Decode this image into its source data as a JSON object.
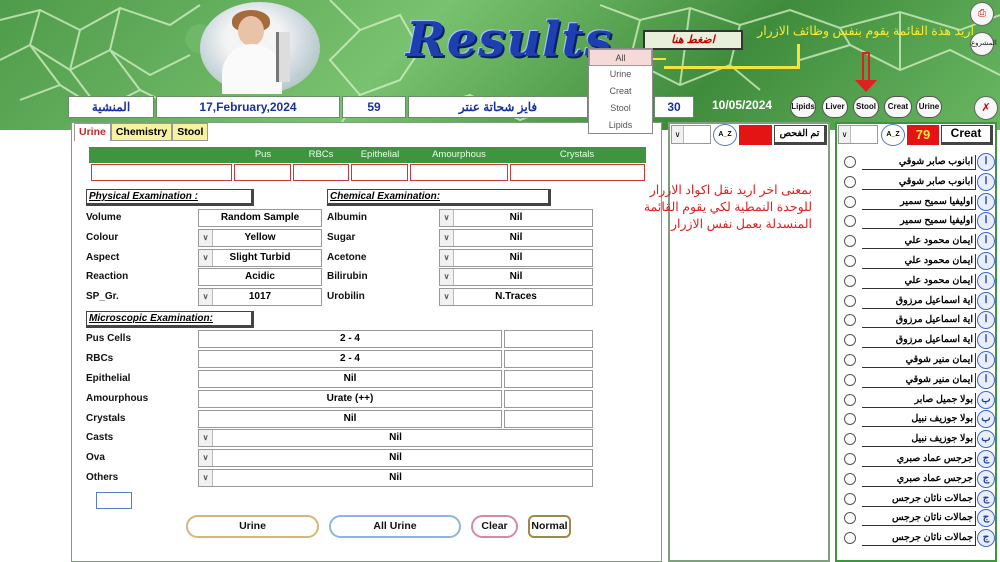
{
  "header": {
    "title": "Results",
    "press_here": "اضغط هنا",
    "note_top": "اريد هذة القائمة يقوم بنفس وظائف الازرار",
    "corner_top": "",
    "corner_project": "المشروع",
    "dropdown_options": [
      "All",
      "Urine",
      "Creat",
      "Stool",
      "Lipids"
    ],
    "dropdown_selected": "All"
  },
  "info_bar": {
    "branch": "المنشية",
    "date": "17,February,2024",
    "number": "59",
    "patient_name": "فايز شحاتة عنتر",
    "age": "30",
    "date2": "10/05/2024"
  },
  "function_buttons": [
    "Lipids",
    "Liver",
    "Stool",
    "Creat",
    "Urine"
  ],
  "tabs": [
    "Urine",
    "Chemistry",
    "Stool"
  ],
  "active_tab": "Urine",
  "summary": {
    "headers": [
      "Pus",
      "RBCs",
      "Epithelial",
      "Amourphous",
      "Crystals"
    ],
    "values": [
      "",
      "",
      "",
      "",
      "",
      ""
    ]
  },
  "physical": {
    "title": "Physical Examination :",
    "rows": [
      {
        "label": "Volume",
        "value": "Random Sample",
        "dropdown": false
      },
      {
        "label": "Colour",
        "value": "Yellow",
        "dropdown": true
      },
      {
        "label": "Aspect",
        "value": "Slight Turbid",
        "dropdown": true
      },
      {
        "label": "Reaction",
        "value": "Acidic",
        "dropdown": false
      },
      {
        "label": "SP_Gr.",
        "value": "1017",
        "dropdown": true
      }
    ]
  },
  "chemical": {
    "title": "Chemical Examination:",
    "rows": [
      {
        "label": "Albumin",
        "value": "Nil"
      },
      {
        "label": "Sugar",
        "value": "Nil"
      },
      {
        "label": "Acetone",
        "value": "Nil"
      },
      {
        "label": "Bilirubin",
        "value": "Nil"
      },
      {
        "label": "Urobilin",
        "value": "N.Traces"
      }
    ]
  },
  "microscopic": {
    "title": "Microscopic Examination:",
    "rows": [
      {
        "label": "Pus Cells",
        "value": "2 - 4",
        "extra": ""
      },
      {
        "label": "RBCs",
        "value": "2 - 4",
        "extra": ""
      },
      {
        "label": "Epithelial",
        "value": "Nil",
        "extra": ""
      },
      {
        "label": "Amourphous",
        "value": "Urate (++)",
        "extra": ""
      },
      {
        "label": "Crystals",
        "value": "Nil",
        "extra": ""
      },
      {
        "label": "Casts",
        "value": "Nil"
      },
      {
        "label": "Ova",
        "value": "Nil"
      },
      {
        "label": "Others",
        "value": "Nil"
      }
    ]
  },
  "action_buttons": {
    "urine": "Urine",
    "all_urine": "All Urine",
    "clear": "Clear",
    "normal": "Normal"
  },
  "note_middle": "بمعنى اخر اريد نقل اكواد الازرار للوحدة النمطية لكي يقوم القائمة المنسدلة بعمل نفس الازرار",
  "mid_panel": {
    "az": "A_Z",
    "done": "تم الفحص"
  },
  "right_panel": {
    "az": "A_Z",
    "count": "79",
    "creat": "Creat",
    "patients": [
      {
        "name": "ابانوب صابر شوقي",
        "letter": "ا"
      },
      {
        "name": "ابانوب صابر شوقي",
        "letter": "ا"
      },
      {
        "name": "اوليفيا سميح سمير",
        "letter": "ا"
      },
      {
        "name": "اوليفيا سميح سمير",
        "letter": "ا"
      },
      {
        "name": "ايمان محمود علي",
        "letter": "ا"
      },
      {
        "name": "ايمان محمود علي",
        "letter": "ا"
      },
      {
        "name": "ايمان محمود علي",
        "letter": "ا"
      },
      {
        "name": "اية اسماعيل مرزوق",
        "letter": "ا"
      },
      {
        "name": "اية اسماعيل مرزوق",
        "letter": "ا"
      },
      {
        "name": "اية اسماعيل مرزوق",
        "letter": "ا"
      },
      {
        "name": "ايمان منير شوقي",
        "letter": "ا"
      },
      {
        "name": "ايمان منير شوقي",
        "letter": "ا"
      },
      {
        "name": "بولا جميل صابر",
        "letter": "ب"
      },
      {
        "name": "بولا جوزيف نبيل",
        "letter": "ب"
      },
      {
        "name": "بولا جوزيف نبيل",
        "letter": "ب"
      },
      {
        "name": "جرجس عماد صبري",
        "letter": "ج"
      },
      {
        "name": "جرجس عماد صبري",
        "letter": "ج"
      },
      {
        "name": "جمالات ناثان جرجس",
        "letter": "ج"
      },
      {
        "name": "جمالات ناثان جرجس",
        "letter": "ج"
      },
      {
        "name": "جمالات ناثان جرجس",
        "letter": "ج"
      }
    ]
  },
  "colors": {
    "header_green": "#4e9b4a",
    "title_blue": "#1d3fb0",
    "note_yellow": "#ffeb2a",
    "note_red": "#e02020",
    "tab_yellow": "#f6f2a0",
    "count_red": "#e41414"
  }
}
